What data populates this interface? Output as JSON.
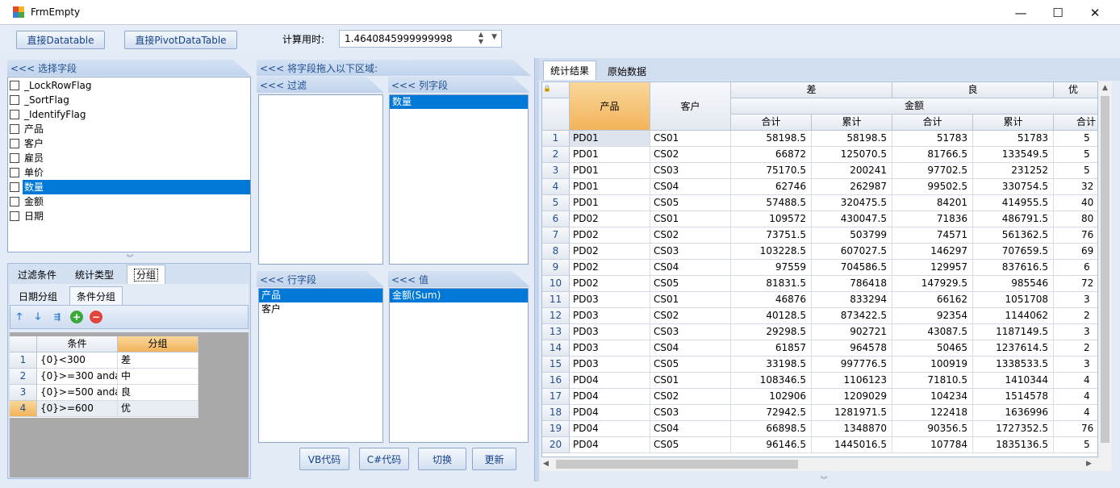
{
  "window": {
    "title": "FrmEmpty",
    "minimize": "—",
    "maximize": "☐",
    "close": "✕"
  },
  "toolbar": {
    "btn_datatable": "直接Datatable",
    "btn_pivot": "直接PivotDataTable",
    "time_label": "计算用时:",
    "time_value": "1.4640845999999998"
  },
  "fields_panel": {
    "header": "<<< 选择字段",
    "fields": [
      {
        "label": "_LockRowFlag",
        "checked": false,
        "selected": false
      },
      {
        "label": "_SortFlag",
        "checked": false,
        "selected": false
      },
      {
        "label": "_IdentifyFlag",
        "checked": false,
        "selected": false
      },
      {
        "label": "产品",
        "checked": false,
        "selected": false
      },
      {
        "label": "客户",
        "checked": false,
        "selected": false
      },
      {
        "label": "雇员",
        "checked": false,
        "selected": false
      },
      {
        "label": "单价",
        "checked": false,
        "selected": false
      },
      {
        "label": "数量",
        "checked": false,
        "selected": true
      },
      {
        "label": "金额",
        "checked": false,
        "selected": false
      },
      {
        "label": "日期",
        "checked": false,
        "selected": false
      }
    ]
  },
  "option_tabs": [
    "过滤条件",
    "统计类型",
    "分组"
  ],
  "group_tabs": [
    "日期分组",
    "条件分组"
  ],
  "cond_grid": {
    "col_condition": "条件",
    "col_group": "分组",
    "rows": [
      {
        "no": "1",
        "cond": "{0}<300",
        "group": "差"
      },
      {
        "no": "2",
        "cond": "{0}>=300 andals",
        "group": "中"
      },
      {
        "no": "3",
        "cond": "{0}>=500 andals",
        "group": "良"
      },
      {
        "no": "4",
        "cond": "{0}>=600",
        "group": "优"
      }
    ]
  },
  "drag_area": {
    "header": "<<< 将字段拖入以下区域:",
    "filter_header": "<<< 过滤",
    "column_header": "<<< 列字段",
    "column_items": [
      "数量"
    ],
    "row_header": "<<< 行字段",
    "row_items": [
      "产品",
      "客户"
    ],
    "value_header": "<<< 值",
    "value_items": [
      "金额(Sum)"
    ]
  },
  "bottom_buttons": {
    "vb": "VB代码",
    "cs": "C#代码",
    "switch": "切换",
    "update": "更新"
  },
  "result_tabs": [
    "统计结果",
    "原始数据"
  ],
  "result_grid": {
    "col_product": "产品",
    "col_customer": "客户",
    "groups": [
      "差",
      "良",
      "优"
    ],
    "amount": "金额",
    "sub_sum": "合计",
    "sub_cum": "累计",
    "rows": [
      {
        "no": "1",
        "p": "PD01",
        "c": "CS01",
        "a": "58198.5",
        "b": "58198.5",
        "d": "51783",
        "e": "51783",
        "f": "5"
      },
      {
        "no": "2",
        "p": "PD01",
        "c": "CS02",
        "a": "66872",
        "b": "125070.5",
        "d": "81766.5",
        "e": "133549.5",
        "f": "5"
      },
      {
        "no": "3",
        "p": "PD01",
        "c": "CS03",
        "a": "75170.5",
        "b": "200241",
        "d": "97702.5",
        "e": "231252",
        "f": "5"
      },
      {
        "no": "4",
        "p": "PD01",
        "c": "CS04",
        "a": "62746",
        "b": "262987",
        "d": "99502.5",
        "e": "330754.5",
        "f": "32"
      },
      {
        "no": "5",
        "p": "PD01",
        "c": "CS05",
        "a": "57488.5",
        "b": "320475.5",
        "d": "84201",
        "e": "414955.5",
        "f": "40"
      },
      {
        "no": "6",
        "p": "PD02",
        "c": "CS01",
        "a": "109572",
        "b": "430047.5",
        "d": "71836",
        "e": "486791.5",
        "f": "80"
      },
      {
        "no": "7",
        "p": "PD02",
        "c": "CS02",
        "a": "73751.5",
        "b": "503799",
        "d": "74571",
        "e": "561362.5",
        "f": "76"
      },
      {
        "no": "8",
        "p": "PD02",
        "c": "CS03",
        "a": "103228.5",
        "b": "607027.5",
        "d": "146297",
        "e": "707659.5",
        "f": "69"
      },
      {
        "no": "9",
        "p": "PD02",
        "c": "CS04",
        "a": "97559",
        "b": "704586.5",
        "d": "129957",
        "e": "837616.5",
        "f": "6"
      },
      {
        "no": "10",
        "p": "PD02",
        "c": "CS05",
        "a": "81831.5",
        "b": "786418",
        "d": "147929.5",
        "e": "985546",
        "f": "72"
      },
      {
        "no": "11",
        "p": "PD03",
        "c": "CS01",
        "a": "46876",
        "b": "833294",
        "d": "66162",
        "e": "1051708",
        "f": "3"
      },
      {
        "no": "12",
        "p": "PD03",
        "c": "CS02",
        "a": "40128.5",
        "b": "873422.5",
        "d": "92354",
        "e": "1144062",
        "f": "2"
      },
      {
        "no": "13",
        "p": "PD03",
        "c": "CS03",
        "a": "29298.5",
        "b": "902721",
        "d": "43087.5",
        "e": "1187149.5",
        "f": "3"
      },
      {
        "no": "14",
        "p": "PD03",
        "c": "CS04",
        "a": "61857",
        "b": "964578",
        "d": "50465",
        "e": "1237614.5",
        "f": "2"
      },
      {
        "no": "15",
        "p": "PD03",
        "c": "CS05",
        "a": "33198.5",
        "b": "997776.5",
        "d": "100919",
        "e": "1338533.5",
        "f": "3"
      },
      {
        "no": "16",
        "p": "PD04",
        "c": "CS01",
        "a": "108346.5",
        "b": "1106123",
        "d": "71810.5",
        "e": "1410344",
        "f": "4"
      },
      {
        "no": "17",
        "p": "PD04",
        "c": "CS02",
        "a": "102906",
        "b": "1209029",
        "d": "104234",
        "e": "1514578",
        "f": "4"
      },
      {
        "no": "18",
        "p": "PD04",
        "c": "CS03",
        "a": "72942.5",
        "b": "1281971.5",
        "d": "122418",
        "e": "1636996",
        "f": "4"
      },
      {
        "no": "19",
        "p": "PD04",
        "c": "CS04",
        "a": "66898.5",
        "b": "1348870",
        "d": "90356.5",
        "e": "1727352.5",
        "f": "76"
      },
      {
        "no": "20",
        "p": "PD04",
        "c": "CS05",
        "a": "96146.5",
        "b": "1445016.5",
        "d": "107784",
        "e": "1835136.5",
        "f": "5"
      }
    ]
  }
}
